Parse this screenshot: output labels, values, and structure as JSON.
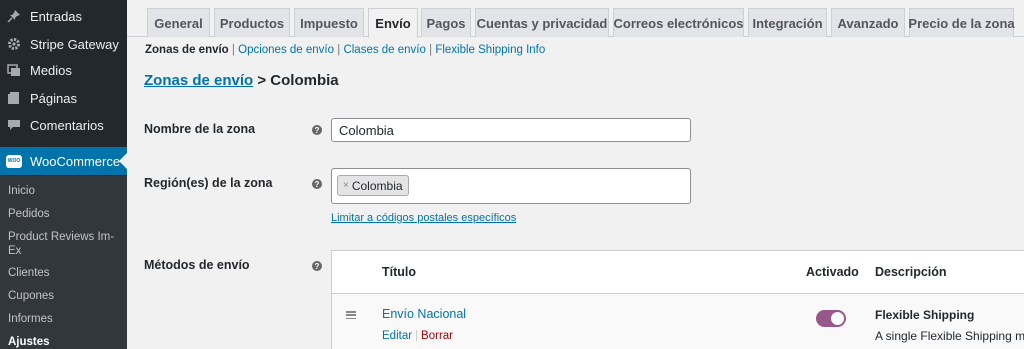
{
  "sidebar": {
    "items": [
      {
        "label": "Entradas",
        "icon": "pin-icon"
      },
      {
        "label": "Stripe Gateway",
        "icon": "gear-icon"
      },
      {
        "label": "Medios",
        "icon": "media-icon"
      },
      {
        "label": "Páginas",
        "icon": "pages-icon"
      },
      {
        "label": "Comentarios",
        "icon": "comments-icon"
      },
      {
        "label": "WooCommerce",
        "icon": "woocommerce-icon",
        "badge": "WOO"
      }
    ],
    "submenu": [
      "Inicio",
      "Pedidos",
      "Product Reviews Im-Ex",
      "Clientes",
      "Cupones",
      "Informes",
      "Ajustes"
    ]
  },
  "tabs": [
    "General",
    "Productos",
    "Impuesto",
    "Envío",
    "Pagos",
    "Cuentas y privacidad",
    "Correos electrónicos",
    "Integración",
    "Avanzado",
    "Precio de la zona"
  ],
  "subsections": {
    "current": "Zonas de envío",
    "links": [
      "Opciones de envío",
      "Clases de envío",
      "Flexible Shipping Info"
    ],
    "separator": "|"
  },
  "breadcrumb": {
    "link": "Zonas de envío",
    "rest": "> Colombia"
  },
  "zone": {
    "name_label": "Nombre de la zona",
    "name_value": "Colombia",
    "region_label": "Región(es) de la zona",
    "region_chip": "Colombia",
    "chip_remove": "×",
    "limit_link": "Limitar a códigos postales específicos",
    "help": "?"
  },
  "methods": {
    "label": "Métodos de envío",
    "headers": {
      "title": "Título",
      "enabled": "Activado",
      "description": "Descripción"
    },
    "rows": [
      {
        "title": "Envío Nacional",
        "edit": "Editar",
        "sep": "|",
        "delete": "Borrar",
        "enabled": true,
        "type": "Flexible Shipping",
        "description": "A single Flexible Shipping me"
      }
    ]
  },
  "colors": {
    "admin_blue": "#0073aa",
    "sidebar_dark": "#23282d",
    "toggle_on": "#96588a"
  }
}
